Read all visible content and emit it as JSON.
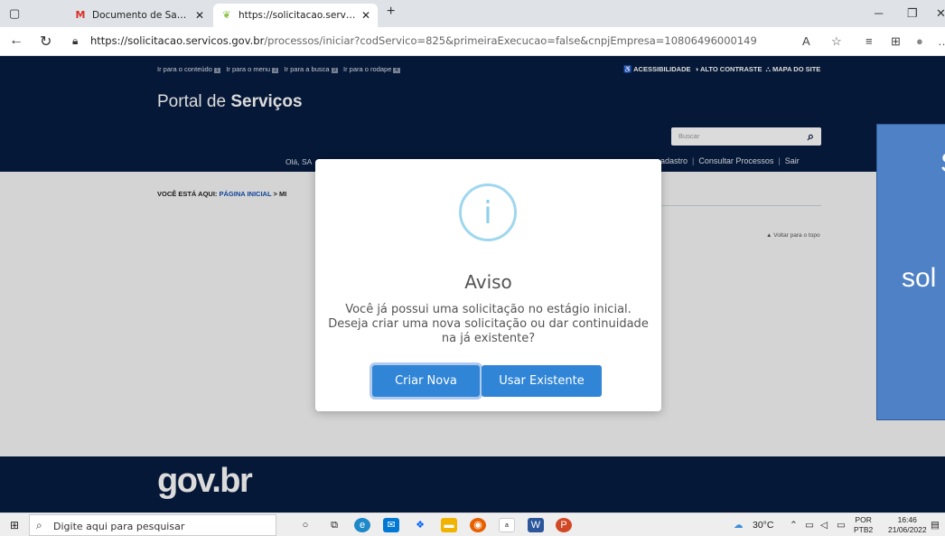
{
  "browser": {
    "tabs": [
      {
        "title": "Documento de Samara Pereira -",
        "favicon": "gmail-icon"
      },
      {
        "title": "https://solicitacao.servicos.gov.b",
        "favicon": "leaf-icon"
      }
    ],
    "new_tab": "+",
    "url_host": "https://solicitacao.servicos.gov.br",
    "url_path": "/processos/iniciar?codServico=825&primeiraExecucao=false&cnpjEmpresa=10806496000149"
  },
  "header": {
    "skip_links": [
      {
        "label": "Ir para o conteúdo",
        "key": "1"
      },
      {
        "label": "Ir para o menu",
        "key": "2"
      },
      {
        "label": "Ir para a busca",
        "key": "3"
      },
      {
        "label": "Ir para o rodape",
        "key": "4"
      }
    ],
    "accessibility": "♿ ACESSIBILIDADE",
    "contrast": "◑ ALTO CONTRASTE",
    "sitemap": "⛬ MAPA DO SITE",
    "portal_prefix": "Portal de ",
    "portal_bold": "Serviços",
    "search_placeholder": "Buscar",
    "greeting": "Olá, SA",
    "menu": [
      "adastro",
      "Consultar Processos",
      "Sair"
    ]
  },
  "breadcrumb": {
    "prefix": "VOCÊ ESTÁ AQUI:",
    "home": "PÁGINA INICIAL",
    "sep": ">",
    "current": "MI"
  },
  "back_to_top": "▲ Voltar para o topo",
  "footer": {
    "logo": "gov.br"
  },
  "side_panel": {
    "line1": "S",
    "line2": "sol"
  },
  "modal": {
    "icon": "i",
    "title": "Aviso",
    "message": "Você já possui uma solicitação no estágio inicial. Deseja criar uma nova solicitação ou dar continuidade na já existente?",
    "btn_new": "Criar Nova",
    "btn_existing": "Usar Existente"
  },
  "taskbar": {
    "search_placeholder": "Digite aqui para pesquisar",
    "weather": "30°C",
    "lang1": "POR",
    "lang2": "PTB2",
    "time": "16:46",
    "date": "21/06/2022"
  }
}
